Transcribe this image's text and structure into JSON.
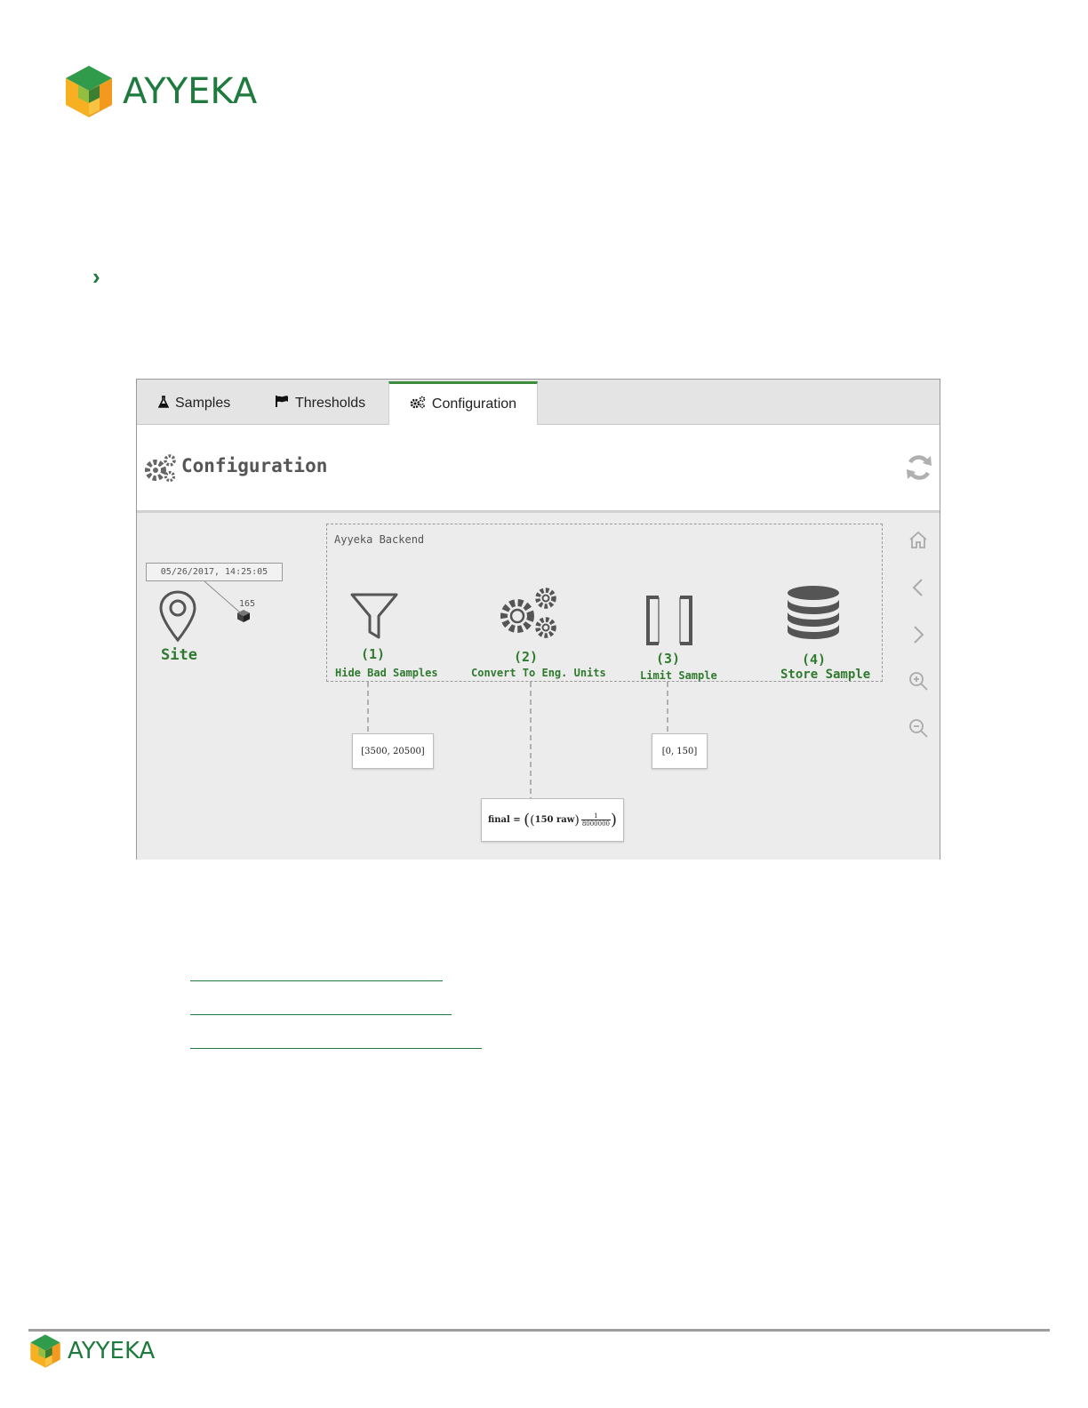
{
  "brand": {
    "name": "AYYEKA",
    "color_primary": "#1f7a3e",
    "color_accent": "#f4a623"
  },
  "nav": {
    "chevron_icon": "chevron-right-icon",
    "chevron_glyph": "›"
  },
  "app": {
    "tabs": [
      {
        "label": "Samples",
        "icon": "flask-icon",
        "active": false
      },
      {
        "label": "Thresholds",
        "icon": "flag-icon",
        "active": false
      },
      {
        "label": "Configuration",
        "icon": "gears-icon",
        "active": true
      }
    ],
    "page_title": "Configuration",
    "refresh_icon": "refresh-icon",
    "diagram": {
      "site": {
        "label": "Site",
        "timestamp": "05/26/2017, 14:25:05",
        "count": "165"
      },
      "backend_label": "Ayyeka Backend",
      "steps": [
        {
          "num": "(1)",
          "label": "Hide Bad Samples",
          "icon": "filter-icon",
          "param": "[3500, 20500]"
        },
        {
          "num": "(2)",
          "label": "Convert To Eng. Units",
          "icon": "gears-icon",
          "param_prefix": "final = ",
          "param_inner": "150 raw",
          "param_frac_num": "1",
          "param_frac_den": "8000000"
        },
        {
          "num": "(3)",
          "label": "Limit Sample",
          "icon": "brackets-icon",
          "param": "[0, 150]"
        },
        {
          "num": "(4)",
          "label": "Store Sample",
          "icon": "database-icon"
        }
      ],
      "toolbar_icons": [
        "home-icon",
        "chevron-left-icon",
        "chevron-right-icon",
        "zoom-in-icon",
        "zoom-out-icon"
      ]
    }
  },
  "links": [
    {},
    {},
    {}
  ]
}
